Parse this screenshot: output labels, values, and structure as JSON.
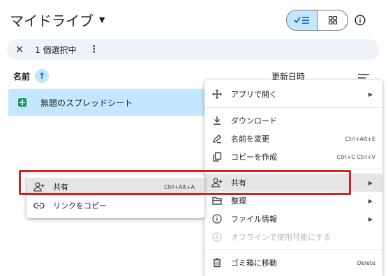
{
  "header": {
    "title": "マイドライブ"
  },
  "selection_bar": {
    "count_text": "1 個選択中"
  },
  "columns": {
    "name": "名前",
    "modified": "更新日時"
  },
  "file": {
    "name": "無題のスプレッドシート"
  },
  "context_menu": {
    "open_with": "アプリで開く",
    "download": "ダウンロード",
    "rename": "名前を変更",
    "rename_shortcut": "Ctrl+Alt+E",
    "copy": "コピーを作成",
    "copy_shortcut": "Ctrl+C Ctrl+V",
    "share": "共有",
    "organize": "整理",
    "file_info": "ファイル情報",
    "offline": "オフラインで使用可能にする",
    "trash": "ゴミ箱に移動",
    "trash_shortcut": "Delete"
  },
  "share_submenu": {
    "share": "共有",
    "share_shortcut": "Ctrl+Alt+A",
    "copy_link": "リンクをコピー"
  },
  "colors": {
    "selection": "#c2e7ff",
    "highlight_box": "#d9201a",
    "sheets_green": "#0f9d58"
  }
}
